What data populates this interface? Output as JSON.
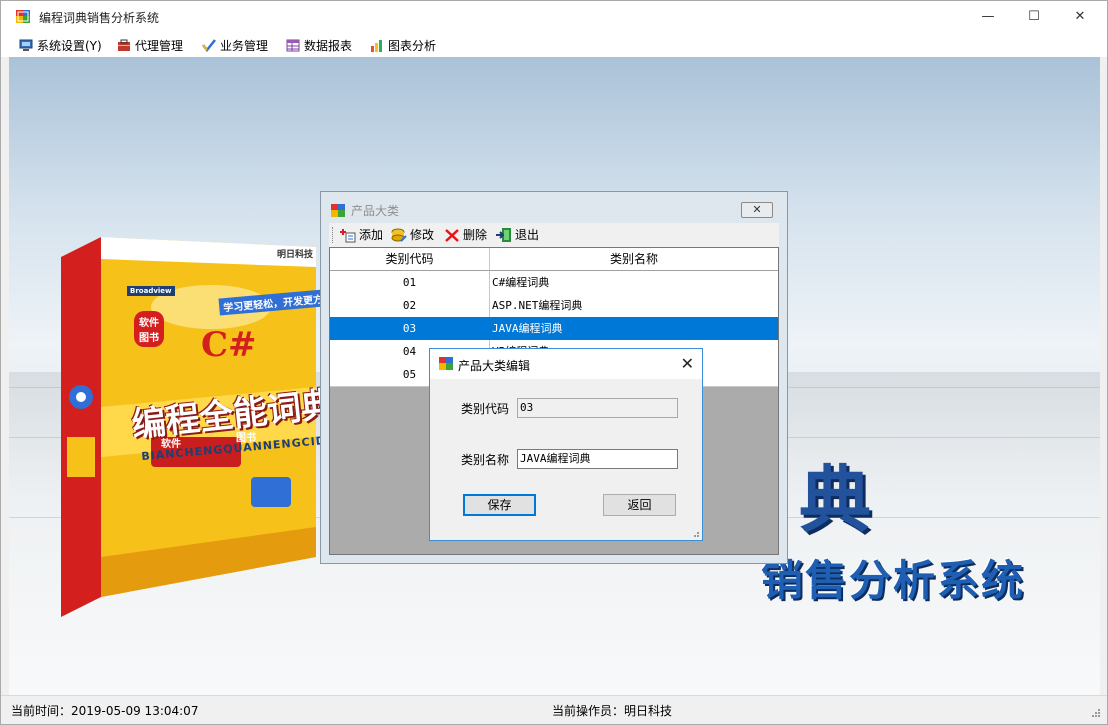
{
  "app": {
    "title": "编程词典销售分析系统",
    "window_controls": {
      "minimize": "—",
      "maximize": "☐",
      "close": "✕"
    }
  },
  "menu": [
    {
      "label": "系统设置(Y)",
      "icon": "system-settings-icon"
    },
    {
      "label": "代理管理",
      "icon": "agent-icon"
    },
    {
      "label": "业务管理",
      "icon": "business-icon"
    },
    {
      "label": "数据报表",
      "icon": "report-icon"
    },
    {
      "label": "图表分析",
      "icon": "chart-icon"
    }
  ],
  "background": {
    "book_cover": {
      "brand": "Broadview",
      "publisher_logo": "明日科技",
      "tagline": "学习更轻松，开发更方便！",
      "badge": "软件 图书",
      "title_lang": "C#",
      "title": "编程全能词典",
      "pinyin": "BIANCHENGQUANNENGCIDIAN",
      "band_left": "软件",
      "band_right": "图书"
    },
    "decor_char": "典",
    "slogan": "销售分析系统"
  },
  "product_window": {
    "title": "产品大类",
    "close_label": "✕",
    "toolbar": [
      {
        "label": "添加",
        "icon": "add-icon"
      },
      {
        "label": "修改",
        "icon": "edit-icon"
      },
      {
        "label": "删除",
        "icon": "delete-icon"
      },
      {
        "label": "退出",
        "icon": "exit-icon"
      }
    ],
    "columns": [
      "类别代码",
      "类别名称"
    ],
    "rows": [
      {
        "code": "01",
        "name": "C#编程词典",
        "selected": false
      },
      {
        "code": "02",
        "name": "ASP.NET编程词典",
        "selected": false
      },
      {
        "code": "03",
        "name": "JAVA编程词典",
        "selected": true
      },
      {
        "code": "04",
        "name": "VB编程词典",
        "selected": false
      },
      {
        "code": "05",
        "name": "",
        "selected": false
      }
    ]
  },
  "edit_dialog": {
    "title": "产品大类编辑",
    "close_label": "✕",
    "code_label": "类别代码",
    "code_value": "03",
    "name_label": "类别名称",
    "name_value": "JAVA编程词典",
    "save_label": "保存",
    "back_label": "返回"
  },
  "status": {
    "time": "当前时间：2019-05-09 13:04:07",
    "operator": "当前操作员：明日科技"
  },
  "colors": {
    "selection": "#0078d7",
    "dialog_border": "#3a8fd6"
  }
}
